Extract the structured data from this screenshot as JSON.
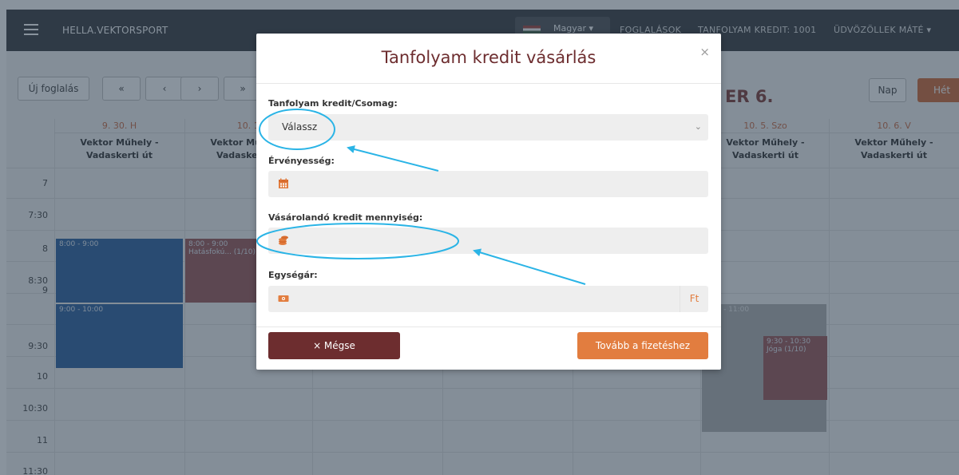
{
  "navbar": {
    "brand": "HELLA.VEKTORSPORT",
    "language": "Magyar",
    "links": [
      "FOGLALÁSOK",
      "TANFOLYAM KREDIT: 1001",
      "ÜDVÖZÖLLEK MÁTÉ"
    ]
  },
  "toolbar": {
    "new_booking": "Új foglalás",
    "nav_first": "«",
    "nav_prev": "‹",
    "nav_next": "›",
    "nav_last": "»",
    "heading": "ER 6.",
    "day_view": "Nap",
    "week_view": "Hét"
  },
  "calendar": {
    "days": [
      {
        "date": "9. 30. H",
        "location": "Vektor Műhely - Vadaskerti út"
      },
      {
        "date": "10. 1.",
        "location": "Vektor Műhely - Vadaskerti út"
      },
      {
        "date": "10. 5. Szo",
        "location": "Vektor Műhely - Vadaskerti út"
      },
      {
        "date": "10. 6. V",
        "location": "Vektor Műhely - Vadaskerti út"
      }
    ],
    "times": [
      "7",
      "7:30",
      "8",
      "8:30",
      "9",
      "9:30",
      "10",
      "10:30",
      "11",
      "11:30"
    ],
    "events": [
      {
        "time": "8:00 - 9:00",
        "title": ""
      },
      {
        "time": "8:00 - 9:00",
        "title": "Hatásfokú... (1/10)"
      },
      {
        "time": "9:00 - 10:00",
        "title": ""
      },
      {
        "time": "9:30 - 11:00",
        "title": ""
      },
      {
        "time": "9:30 - 10:30",
        "title": "Jóga (1/10)"
      }
    ]
  },
  "modal": {
    "title": "Tanfolyam kredit vásárlás",
    "close": "×",
    "package_label": "Tanfolyam kredit/Csomag:",
    "package_value": "Válassz",
    "validity_label": "Érvényesség:",
    "validity_value": "",
    "quantity_label": "Vásárolandó kredit mennyiség:",
    "quantity_value": "",
    "unit_price_label": "Egységár:",
    "unit_price_value": "",
    "currency": "Ft",
    "cancel": "× Mégse",
    "continue": "Tovább a fizetéshez"
  },
  "colors": {
    "accent": "#e27d3f",
    "brand_dark": "#6d2d2f",
    "annotation": "#2ab4e6"
  },
  "icons": [
    "calendar-icon",
    "coins-icon",
    "money-bill-icon",
    "close-icon",
    "chevron-down-icon",
    "hamburger-icon"
  ]
}
